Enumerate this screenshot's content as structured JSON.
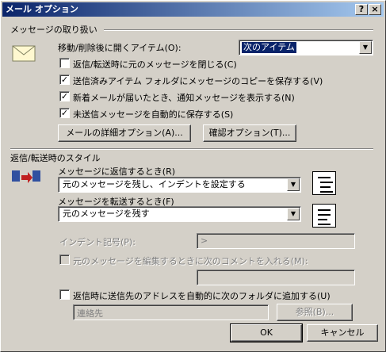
{
  "window": {
    "title": "メール オプション",
    "help_btn": "?",
    "close_btn": "×"
  },
  "message_handling": {
    "section_label": "メッセージの取り扱い",
    "after_move_label": "移動/削除後に開くアイテム(O):",
    "after_move_value": "次のアイテム",
    "checkboxes": [
      {
        "label": "返信/転送時に元のメッセージを閉じる(C)",
        "checked": false
      },
      {
        "label": "送信済みアイテム フォルダにメッセージのコピーを保存する(V)",
        "checked": true
      },
      {
        "label": "新着メールが届いたとき、通知メッセージを表示する(N)",
        "checked": true
      },
      {
        "label": "未送信メッセージを自動的に保存する(S)",
        "checked": true
      }
    ],
    "advanced_button": "メールの詳細オプション(A)...",
    "tracking_button": "確認オプション(T)..."
  },
  "reply_forward": {
    "section_label": "返信/転送時のスタイル",
    "reply_label": "メッセージに返信するとき(R)",
    "reply_value": "元のメッセージを残し、インデントを設定する",
    "forward_label": "メッセージを転送するとき(F)",
    "forward_value": "元のメッセージを残す",
    "indent_label": "インデント記号(P):",
    "indent_value": ">",
    "comment_label": "元のメッセージを編集するときに次のコメントを入れる(M):",
    "comment_checked": false,
    "add_address_label": "返信時に送信先のアドレスを自動的に次のフォルダに追加する(U)",
    "add_address_checked": false,
    "folder_value": "連絡先",
    "browse_button": "参照(B)..."
  },
  "footer": {
    "ok": "OK",
    "cancel": "キャンセル"
  },
  "check_mark": "✓"
}
